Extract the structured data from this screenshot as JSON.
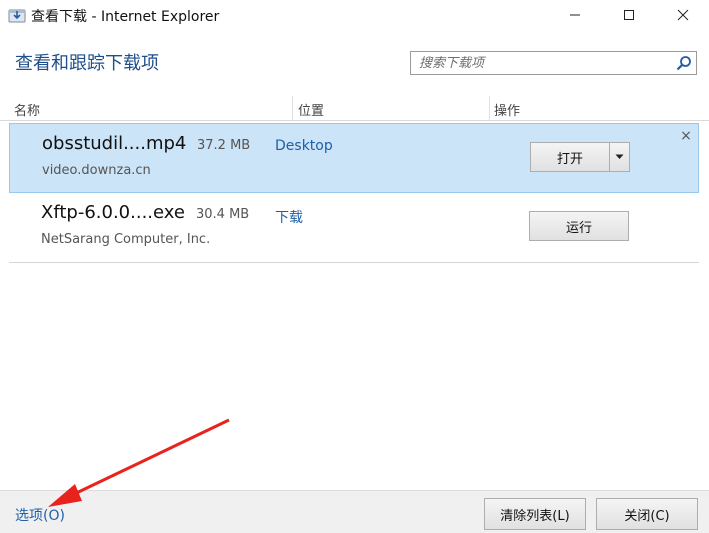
{
  "window": {
    "title": "查看下载 - Internet Explorer",
    "controls": {
      "minimize": "—",
      "maximize": "☐",
      "close": "✕"
    }
  },
  "header": {
    "title": "查看和跟踪下载项",
    "search": {
      "placeholder": "搜索下载项",
      "value": ""
    }
  },
  "columns": [
    "名称",
    "位置",
    "操作"
  ],
  "downloads": [
    {
      "name": "obsstudil....mp4",
      "size": "37.2 MB",
      "source": "video.downza.cn",
      "location": "Desktop",
      "action": "打开",
      "has_dropdown": true,
      "selected": true,
      "remove_icon": "×"
    },
    {
      "name": "Xftp-6.0.0....exe",
      "size": "30.4 MB",
      "source": "NetSarang Computer, Inc.",
      "location": "下载",
      "action": "运行",
      "has_dropdown": false,
      "selected": false
    }
  ],
  "footer": {
    "options_label": "选项(O)",
    "clear_list_label": "清除列表(L)",
    "close_label": "关闭(C)"
  },
  "colors": {
    "accent_blue": "#1f5fa8",
    "title_blue": "#1f4f8a",
    "selected_row_bg": "#cce4f7",
    "annotation_arrow": "#e8231e"
  },
  "icons": {
    "app": "ie-download-icon",
    "search": "search-icon",
    "dropdown": "chevron-down-icon"
  }
}
